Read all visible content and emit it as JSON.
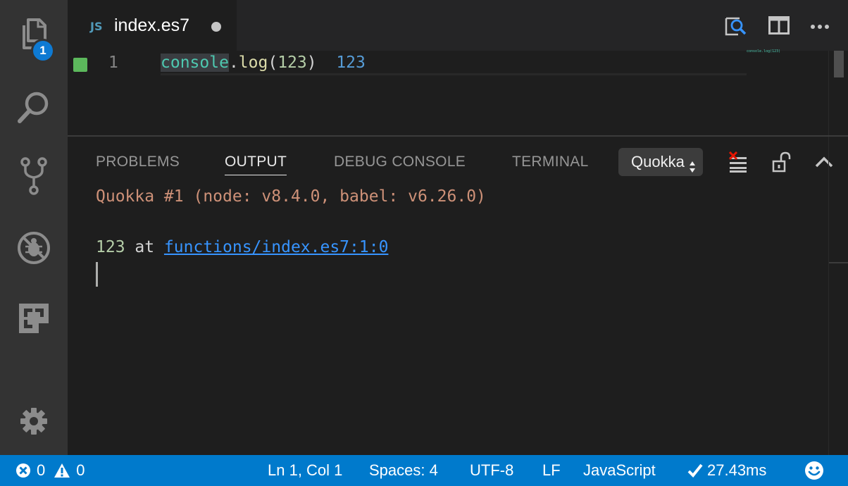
{
  "activity_bar": {
    "items": [
      {
        "name": "explorer",
        "icon": "files-icon",
        "badge": "1"
      },
      {
        "name": "search",
        "icon": "search-icon"
      },
      {
        "name": "source-control",
        "icon": "source-control-icon"
      },
      {
        "name": "debug",
        "icon": "no-bug-icon"
      },
      {
        "name": "extensions",
        "icon": "extensions-icon"
      }
    ],
    "manage_icon": "gear-icon"
  },
  "editor": {
    "tab": {
      "lang_badge": "JS",
      "title": "index.es7",
      "dirty": true
    },
    "title_actions": [
      "open-preview-icon",
      "split-editor-icon",
      "more-actions-icon"
    ],
    "lines": [
      {
        "number": "1",
        "coverage": "covered",
        "tokens": {
          "object": "console",
          "dot": ".",
          "method": "log",
          "open_paren": "(",
          "arg": "123",
          "close_paren": ")"
        },
        "inline_value": "123"
      }
    ],
    "minimap_text": "console.log(123)"
  },
  "panel": {
    "tabs": [
      {
        "label": "PROBLEMS",
        "active": false
      },
      {
        "label": "OUTPUT",
        "active": true
      },
      {
        "label": "DEBUG CONSOLE",
        "active": false
      },
      {
        "label": "TERMINAL",
        "active": false
      }
    ],
    "channel_select": "Quokka",
    "actions": [
      "clear-output-icon",
      "scroll-lock-icon",
      "maximize-panel-icon"
    ],
    "output": {
      "header": "Quokka #1 (node: v8.4.0, babel: v6.26.0)",
      "value": "123",
      "at": " at ",
      "link": "functions/index.es7:1:0"
    }
  },
  "status_bar": {
    "errors": "0",
    "warnings": "0",
    "position": "Ln 1, Col 1",
    "indentation": "Spaces: 4",
    "encoding": "UTF-8",
    "eol": "LF",
    "language": "JavaScript",
    "quokka_time": "27.43ms",
    "feedback_icon": "smiley-icon"
  },
  "colors": {
    "accent": "#007acc",
    "coverage_covered": "#5cb85c",
    "output_header": "#ce9178",
    "link": "#3794ff"
  }
}
